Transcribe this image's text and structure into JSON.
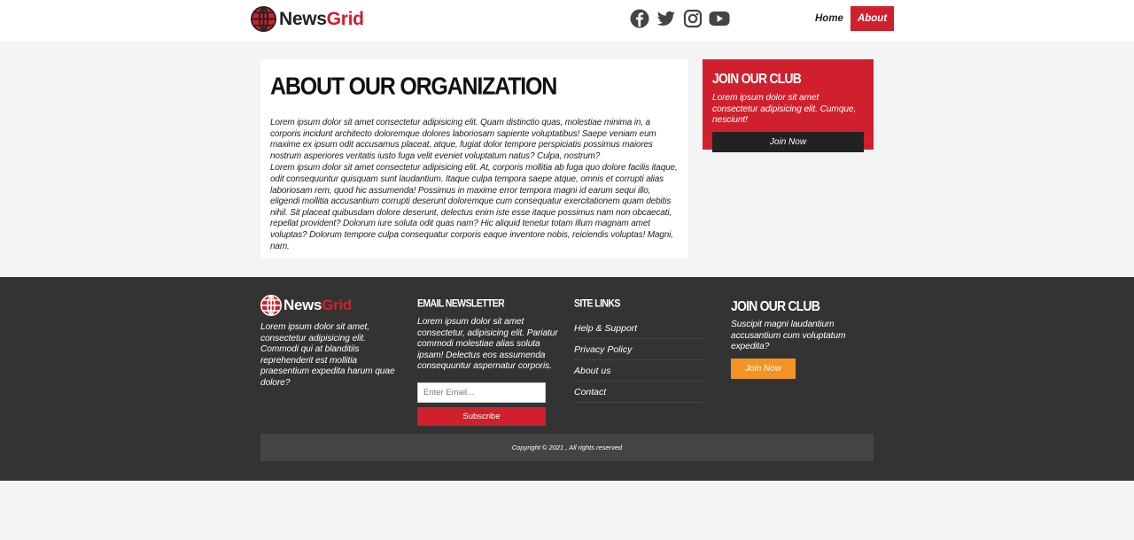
{
  "header": {
    "logo": {
      "part1": "News",
      "part2": "Grid"
    },
    "social_icons": [
      "facebook-icon",
      "twitter-icon",
      "instagram-icon",
      "youtube-icon"
    ],
    "nav": [
      {
        "label": "Home",
        "active": false
      },
      {
        "label": "About",
        "active": true
      }
    ]
  },
  "article": {
    "title": "ABOUT OUR ORGANIZATION",
    "paragraphs": [
      "Lorem ipsum dolor sit amet consectetur adipisicing elit. Quam distinctio quas, molestiae minima in, a corporis incidunt architecto doloremque dolores laboriosam sapiente voluptatibus! Saepe veniam eum maxime ex ipsum odit accusamus placeat, atque, fugiat dolor tempore perspiciatis possimus maiores nostrum asperiores veritatis iusto fuga velit eveniet voluptatum natus? Culpa, nostrum?",
      "Lorem ipsum dolor sit amet consectetur adipisicing elit. At, corporis mollitia ab fuga quo dolore facilis itaque, odit consequuntur quisquam sunt laudantium. Itaque culpa tempora saepe atque, omnis et corrupti alias laboriosam rem, quod hic assumenda! Possimus in maxime error tempora magni id earum sequi illo, eligendi mollitia accusantium corrupti deserunt doloremque cum consequatur exercitationem quam debitis nihil. Sit placeat quibusdam dolore deserunt, delectus enim iste esse itaque possimus nam non obcaecati, repellat provident? Dolorum iure soluta odit quas nam? Hic aliquid tenetur totam illum magnam amet voluptas? Dolorum tempore culpa consequatur corporis eaque inventore nobis, reiciendis voluptas! Magni, nam."
    ]
  },
  "sidebar": {
    "title": "JOIN OUR CLUB",
    "text": "Lorem ipsum dolor sit amet consectetur adipisicing elit. Cumque, nesciunt!",
    "button": "Join Now"
  },
  "footer": {
    "about_text": "Lorem ipsum dolor sit amet, consectetur adipisicing elit. Commodi qui at blanditiis reprehenderit est mollitia praesentium expedita harum quae dolore?",
    "newsletter": {
      "title": "EMAIL NEWSLETTER",
      "text": "Lorem ipsum dolor sit amet consectetur, adipisicing elit. Pariatur commodi molestiae alias soluta ipsam! Delectus eos assumenda consequuntur aspernatur corporis.",
      "placeholder": "Enter Email...",
      "button": "Subscribe"
    },
    "site_links": {
      "title": "SITE LINKS",
      "items": [
        "Help & Support",
        "Privacy Policy",
        "About us",
        "Contact"
      ]
    },
    "club": {
      "title": "JOIN OUR CLUB",
      "text": "Suscipit magni laudantium accusantium cum voluptatum expedita?",
      "button": "Join Now"
    },
    "copyright": "Copyright © 2021 , All rights reserved"
  },
  "colors": {
    "accent": "#d0202e",
    "footer_bg": "#333333",
    "orange": "#f39322"
  }
}
